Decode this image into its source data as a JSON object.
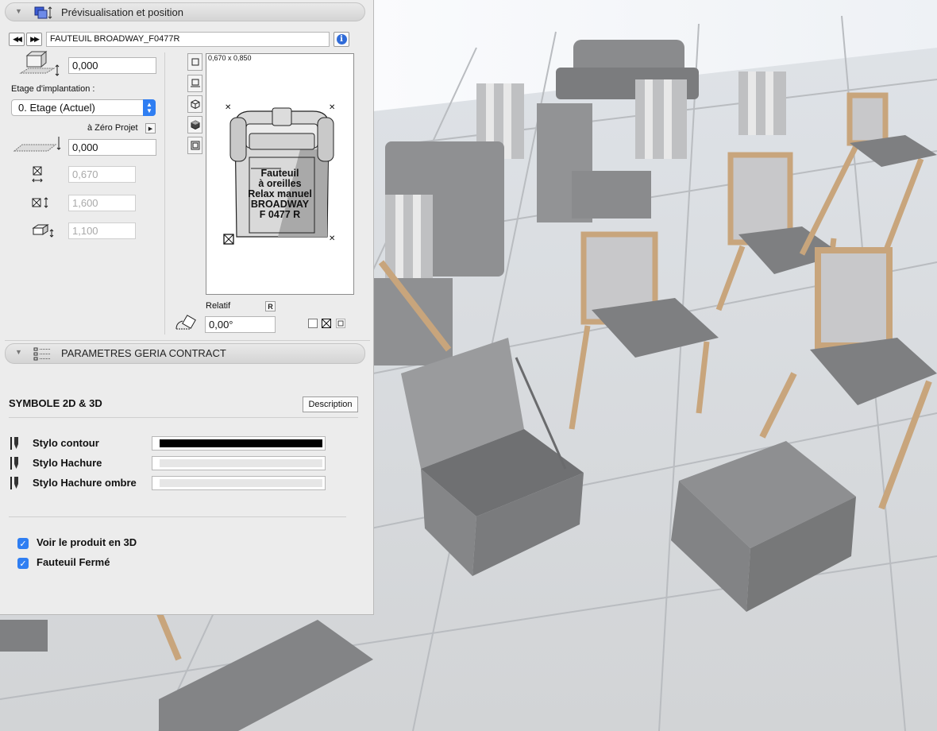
{
  "preview_section": {
    "title": "Prévisualisation et position",
    "object_name": "FAUTEUIL BROADWAY_F0477R",
    "elevation_value": "0,000",
    "floor_label": "Etage d'implantation :",
    "floor_selected": "0. Etage (Actuel)",
    "zero_label": "à Zéro Projet",
    "zero_value": "0,000",
    "width_value": "0,670",
    "depth_value": "1,600",
    "height_value": "1,100",
    "preview_dims": "0,670 x 0,850",
    "preview_text": [
      "Fauteuil",
      "à oreilles",
      "Relax manuel",
      "BROADWAY",
      "F 0477 R"
    ],
    "relatif_label": "Relatif",
    "relatif_button": "R",
    "angle_value": "0,00°"
  },
  "params_section": {
    "title": "PARAMETRES GERIA CONTRACT"
  },
  "symbol": {
    "heading": "SYMBOLE 2D & 3D",
    "description_button": "Description",
    "pens": [
      {
        "label": "Stylo contour",
        "color": "#000000"
      },
      {
        "label": "Stylo Hachure",
        "color": "#e6e6e6"
      },
      {
        "label": "Stylo Hachure ombre",
        "color": "#e6e6e6"
      }
    ],
    "checkboxes": [
      {
        "label": "Voir le produit en 3D",
        "checked": true
      },
      {
        "label": "Fauteuil Fermé",
        "checked": true
      }
    ]
  },
  "colors": {
    "accent": "#2f7ef2"
  }
}
